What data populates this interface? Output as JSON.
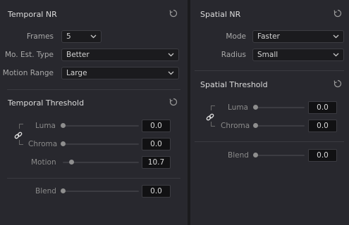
{
  "temporal_nr": {
    "title": "Temporal NR",
    "frames": {
      "label": "Frames",
      "value": "5"
    },
    "mo_est_type": {
      "label": "Mo. Est. Type",
      "value": "Better"
    },
    "motion_range": {
      "label": "Motion Range",
      "value": "Large"
    }
  },
  "temporal_threshold": {
    "title": "Temporal Threshold",
    "luma": {
      "label": "Luma",
      "value": "0.0",
      "level": 0.0
    },
    "chroma": {
      "label": "Chroma",
      "value": "0.0",
      "level": 0.0
    },
    "motion": {
      "label": "Motion",
      "value": "10.7",
      "level": 0.107
    },
    "blend": {
      "label": "Blend",
      "value": "0.0",
      "level": 0.0
    }
  },
  "spatial_nr": {
    "title": "Spatial NR",
    "mode": {
      "label": "Mode",
      "value": "Faster"
    },
    "radius": {
      "label": "Radius",
      "value": "Small"
    }
  },
  "spatial_threshold": {
    "title": "Spatial Threshold",
    "luma": {
      "label": "Luma",
      "value": "0.0",
      "level": 0.0
    },
    "chroma": {
      "label": "Chroma",
      "value": "0.0",
      "level": 0.0
    },
    "blend": {
      "label": "Blend",
      "value": "0.0",
      "level": 0.0
    }
  },
  "icons": {
    "reset": "reset-icon",
    "link": "link-icon",
    "dropdown": "chevron-down-icon"
  },
  "colors": {
    "background": "#1b1b1d",
    "panel": "#28282e",
    "field": "#111113",
    "knob": "#8e8e8e"
  }
}
